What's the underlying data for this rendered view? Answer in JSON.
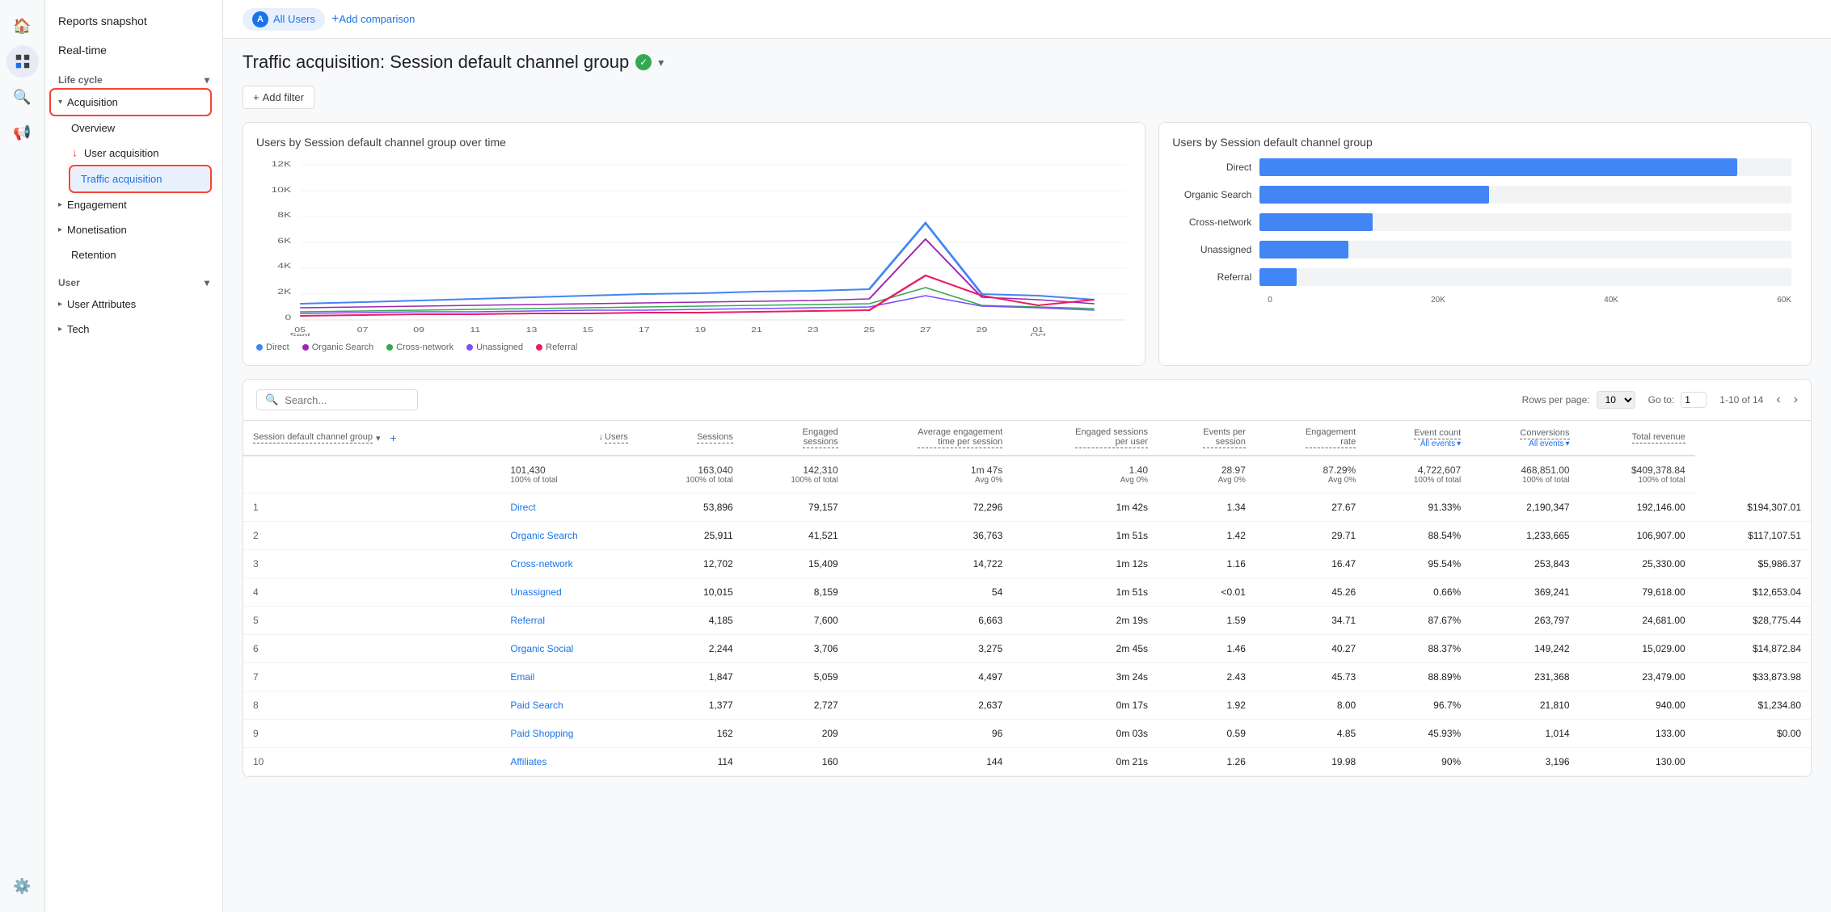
{
  "sidebar": {
    "reports_snapshot": "Reports snapshot",
    "real_time": "Real-time",
    "lifecycle_section": "Life cycle",
    "acquisition_label": "Acquisition",
    "overview_label": "Overview",
    "user_acquisition_label": "User acquisition",
    "traffic_acquisition_label": "Traffic acquisition",
    "engagement_label": "Engagement",
    "monetisation_label": "Monetisation",
    "retention_label": "Retention",
    "user_section": "User",
    "user_attributes_label": "User Attributes",
    "tech_label": "Tech"
  },
  "topbar": {
    "user_label": "All Users",
    "add_comparison": "Add comparison"
  },
  "page": {
    "title": "Traffic acquisition: Session default channel group",
    "filter_btn": "Add filter"
  },
  "line_chart": {
    "title": "Users by Session default channel group over time",
    "y_labels": [
      "12K",
      "10K",
      "8K",
      "6K",
      "4K",
      "2K",
      "0"
    ],
    "x_labels": [
      "05\nSept",
      "07",
      "09",
      "11",
      "13",
      "15",
      "17",
      "19",
      "21",
      "23",
      "25",
      "27",
      "29",
      "01\nOct"
    ],
    "legend": [
      {
        "label": "Direct",
        "color": "#4285f4"
      },
      {
        "label": "Organic Search",
        "color": "#9c27b0"
      },
      {
        "label": "Cross-network",
        "color": "#34a853"
      },
      {
        "label": "Unassigned",
        "color": "#7c4dff"
      },
      {
        "label": "Referral",
        "color": "#e91e63"
      }
    ]
  },
  "bar_chart": {
    "title": "Users by Session default channel group",
    "x_labels": [
      "0",
      "20K",
      "40K",
      "60K"
    ],
    "bars": [
      {
        "label": "Direct",
        "value": 53896,
        "max": 60000,
        "pct": 89.8
      },
      {
        "label": "Organic Search",
        "value": 25911,
        "max": 60000,
        "pct": 43.2
      },
      {
        "label": "Cross-network",
        "value": 12702,
        "max": 60000,
        "pct": 21.2
      },
      {
        "label": "Unassigned",
        "value": 10015,
        "max": 60000,
        "pct": 16.7
      },
      {
        "label": "Referral",
        "value": 4185,
        "max": 60000,
        "pct": 7.0
      }
    ]
  },
  "table": {
    "search_placeholder": "Search...",
    "rows_per_page_label": "Rows per page:",
    "rows_per_page_value": "10",
    "go_to_label": "Go to:",
    "go_to_value": "1",
    "pagination_info": "1-10 of 14",
    "col_channel": "Session default channel group",
    "col_users": "↓ Users",
    "col_sessions": "Sessions",
    "col_engaged_sessions": "Engaged sessions",
    "col_avg_engagement": "Average engagement time per session",
    "col_engaged_per_user": "Engaged sessions per user",
    "col_events_per_session": "Events per session",
    "col_engagement_rate": "Engagement rate",
    "col_event_count": "Event count",
    "col_event_count_sub": "All events",
    "col_conversions": "Conversions",
    "col_conversions_sub": "All events",
    "col_total_revenue": "Total revenue",
    "total_row": {
      "users": "101,430",
      "users_pct": "100% of total",
      "sessions": "163,040",
      "sessions_pct": "100% of total",
      "engaged_sessions": "142,310",
      "engaged_sessions_pct": "100% of total",
      "avg_engagement": "1m 47s",
      "avg_engagement_pct": "Avg 0%",
      "engaged_per_user": "1.40",
      "engaged_per_user_pct": "Avg 0%",
      "events_per_session": "28.97",
      "events_per_session_pct": "Avg 0%",
      "engagement_rate": "87.29%",
      "engagement_rate_pct": "Avg 0%",
      "event_count": "4,722,607",
      "event_count_pct": "100% of total",
      "conversions": "468,851.00",
      "conversions_pct": "100% of total",
      "total_revenue": "$409,378.84",
      "total_revenue_pct": "100% of total"
    },
    "rows": [
      {
        "rank": "1",
        "channel": "Direct",
        "users": "53,896",
        "sessions": "79,157",
        "engaged_sessions": "72,296",
        "avg_engagement": "1m 42s",
        "engaged_per_user": "1.34",
        "events_per_session": "27.67",
        "engagement_rate": "91.33%",
        "event_count": "2,190,347",
        "conversions": "192,146.00",
        "total_revenue": "$194,307.01"
      },
      {
        "rank": "2",
        "channel": "Organic Search",
        "users": "25,911",
        "sessions": "41,521",
        "engaged_sessions": "36,763",
        "avg_engagement": "1m 51s",
        "engaged_per_user": "1.42",
        "events_per_session": "29.71",
        "engagement_rate": "88.54%",
        "event_count": "1,233,665",
        "conversions": "106,907.00",
        "total_revenue": "$117,107.51"
      },
      {
        "rank": "3",
        "channel": "Cross-network",
        "users": "12,702",
        "sessions": "15,409",
        "engaged_sessions": "14,722",
        "avg_engagement": "1m 12s",
        "engaged_per_user": "1.16",
        "events_per_session": "16.47",
        "engagement_rate": "95.54%",
        "event_count": "253,843",
        "conversions": "25,330.00",
        "total_revenue": "$5,986.37"
      },
      {
        "rank": "4",
        "channel": "Unassigned",
        "users": "10,015",
        "sessions": "8,159",
        "engaged_sessions": "54",
        "avg_engagement": "1m 51s",
        "engaged_per_user": "<0.01",
        "events_per_session": "45.26",
        "engagement_rate": "0.66%",
        "event_count": "369,241",
        "conversions": "79,618.00",
        "total_revenue": "$12,653.04"
      },
      {
        "rank": "5",
        "channel": "Referral",
        "users": "4,185",
        "sessions": "7,600",
        "engaged_sessions": "6,663",
        "avg_engagement": "2m 19s",
        "engaged_per_user": "1.59",
        "events_per_session": "34.71",
        "engagement_rate": "87.67%",
        "event_count": "263,797",
        "conversions": "24,681.00",
        "total_revenue": "$28,775.44"
      },
      {
        "rank": "6",
        "channel": "Organic Social",
        "users": "2,244",
        "sessions": "3,706",
        "engaged_sessions": "3,275",
        "avg_engagement": "2m 45s",
        "engaged_per_user": "1.46",
        "events_per_session": "40.27",
        "engagement_rate": "88.37%",
        "event_count": "149,242",
        "conversions": "15,029.00",
        "total_revenue": "$14,872.84"
      },
      {
        "rank": "7",
        "channel": "Email",
        "users": "1,847",
        "sessions": "5,059",
        "engaged_sessions": "4,497",
        "avg_engagement": "3m 24s",
        "engaged_per_user": "2.43",
        "events_per_session": "45.73",
        "engagement_rate": "88.89%",
        "event_count": "231,368",
        "conversions": "23,479.00",
        "total_revenue": "$33,873.98"
      },
      {
        "rank": "8",
        "channel": "Paid Search",
        "users": "1,377",
        "sessions": "2,727",
        "engaged_sessions": "2,637",
        "avg_engagement": "0m 17s",
        "engaged_per_user": "1.92",
        "events_per_session": "8.00",
        "engagement_rate": "96.7%",
        "event_count": "21,810",
        "conversions": "940.00",
        "total_revenue": "$1,234.80"
      },
      {
        "rank": "9",
        "channel": "Paid Shopping",
        "users": "162",
        "sessions": "209",
        "engaged_sessions": "96",
        "avg_engagement": "0m 03s",
        "engaged_per_user": "0.59",
        "events_per_session": "4.85",
        "engagement_rate": "45.93%",
        "event_count": "1,014",
        "conversions": "133.00",
        "total_revenue": "$0.00"
      },
      {
        "rank": "10",
        "channel": "Affiliates",
        "users": "114",
        "sessions": "160",
        "engaged_sessions": "144",
        "avg_engagement": "0m 21s",
        "engaged_per_user": "1.26",
        "events_per_session": "19.98",
        "engagement_rate": "90%",
        "event_count": "3,196",
        "conversions": "130.00",
        "total_revenue": ""
      }
    ]
  }
}
